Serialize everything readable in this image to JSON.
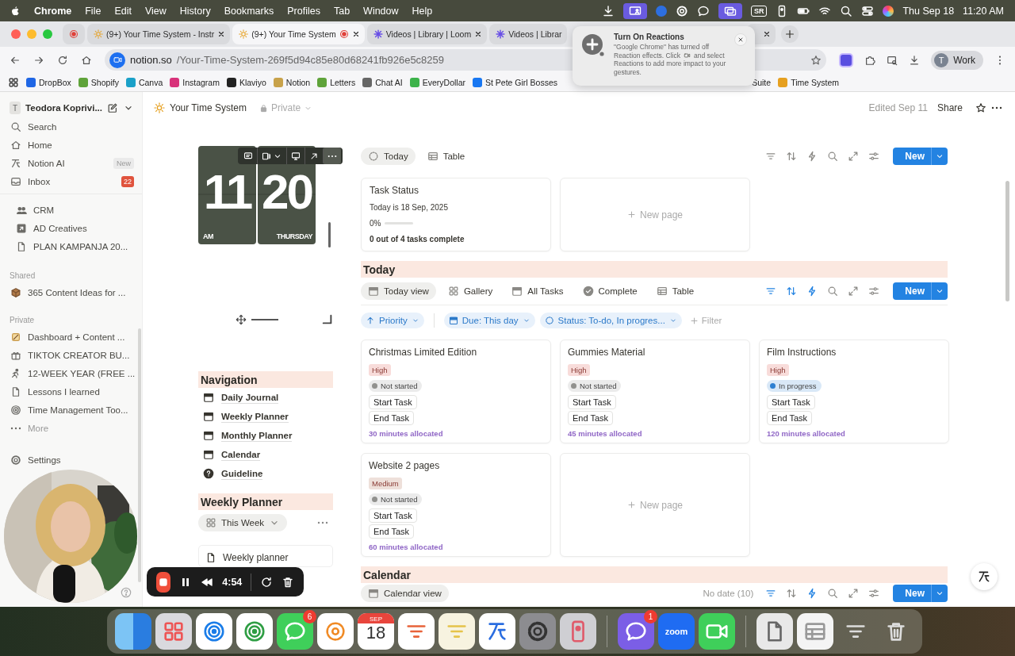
{
  "menubar": {
    "app": "Chrome",
    "menus": [
      "File",
      "Edit",
      "View",
      "History",
      "Bookmarks",
      "Profiles",
      "Tab",
      "Window",
      "Help"
    ],
    "status_label": "SR",
    "date": "Thu Sep 18",
    "time": "11:20 AM"
  },
  "tabs": [
    {
      "kind": "pinned",
      "selected": false,
      "recording": true,
      "closable": false
    },
    {
      "kind": "sun",
      "title": "(9+) Your Time System - Instr",
      "selected": false,
      "recording": false,
      "closable": true
    },
    {
      "kind": "sun",
      "title": "(9+) Your Time System",
      "selected": true,
      "recording": true,
      "closable": true
    },
    {
      "kind": "asterisk",
      "title": "Videos | Library | Loom",
      "selected": false,
      "recording": false,
      "closable": true
    },
    {
      "kind": "asterisk",
      "title": "Videos | Librar",
      "selected": false,
      "recording": false,
      "closable": false
    },
    {
      "kind": "blank",
      "selected": false,
      "recording": false,
      "closable": true
    }
  ],
  "address": {
    "host": "notion.so",
    "path": "/Your-Time-System-269f5d94c85e80d68241fb926e5c8259"
  },
  "profile": {
    "initial": "T",
    "label": "Work"
  },
  "bookmarks": [
    {
      "label": "DropBox",
      "favicon": true
    },
    {
      "label": "Shopify",
      "favicon": true
    },
    {
      "label": "Canva",
      "favicon": true
    },
    {
      "label": "Instagram",
      "favicon": true
    },
    {
      "label": "Klaviyo",
      "favicon": true
    },
    {
      "label": "Notion",
      "favicon": true
    },
    {
      "label": "Letters",
      "favicon": true
    },
    {
      "label": "Chat AI",
      "favicon": true
    },
    {
      "label": "EveryDollar",
      "favicon": true
    },
    {
      "label": "St Pete Girl Bosses",
      "favicon": true
    },
    {
      "label": "Suite",
      "favicon": false
    },
    {
      "label": "Time System",
      "favicon": true
    }
  ],
  "popup": {
    "title": "Turn On Reactions",
    "lines": [
      "\"Google Chrome\" has turned off",
      "Reaction effects. Click",
      "and select",
      "Reactions to add more impact to your",
      "gestures."
    ]
  },
  "sidebar": {
    "workspace": {
      "initial": "T",
      "name": "Teodora Koprivi..."
    },
    "nav": [
      {
        "label": "Search"
      },
      {
        "label": "Home"
      },
      {
        "label": "Notion AI",
        "badge": "New"
      },
      {
        "label": "Inbox",
        "count": "22"
      }
    ],
    "pages": [
      "CRM",
      "AD Creatives",
      "PLAN KAMPANJA 20..."
    ],
    "shared_label": "Shared",
    "shared": [
      "365 Content Ideas for ..."
    ],
    "private_label": "Private",
    "private": [
      "Dashboard + Content ...",
      "TIKTOK CREATOR BU...",
      "12-WEEK YEAR (FREE ...",
      "Lessons I learned",
      "Time Management Too..."
    ],
    "more": "More",
    "settings": "Settings"
  },
  "page": {
    "title": "Your Time System",
    "visibility": "Private",
    "edited": "Edited Sep 11",
    "share": "Share",
    "clock": {
      "hour": "11",
      "minute": "20",
      "period": "AM",
      "weekday": "THURSDAY"
    },
    "navigation": {
      "heading": "Navigation",
      "links": [
        {
          "label": "Daily Journal",
          "kind": "calendar"
        },
        {
          "label": "Weekly Planner",
          "kind": "calendar"
        },
        {
          "label": "Monthly Planner",
          "kind": "calendar"
        },
        {
          "label": "Calendar",
          "kind": "calendar"
        },
        {
          "label": "Guideline",
          "kind": "help"
        }
      ]
    },
    "weekly_planner": {
      "heading": "Weekly Planner",
      "view": "This Week",
      "items": [
        "Weekly planner"
      ]
    },
    "status_db": {
      "views": [
        {
          "label": "Today",
          "selected": true
        },
        {
          "label": "Table",
          "selected": false
        }
      ],
      "filter_on": false,
      "sort_on": false,
      "automation_on": false,
      "new": "New",
      "task_status": {
        "title": "Task Status",
        "date": "Today is 18 Sep, 2025",
        "percent": "0%",
        "summary": "0 out of 4 tasks complete"
      },
      "new_page": "New page"
    },
    "today": {
      "heading": "Today",
      "views": [
        {
          "label": "Today view",
          "selected": true
        },
        {
          "label": "Gallery",
          "selected": false
        },
        {
          "label": "All Tasks",
          "selected": false
        },
        {
          "label": "Complete",
          "selected": false
        },
        {
          "label": "Table",
          "selected": false
        }
      ],
      "filter_on": true,
      "sort_on": true,
      "automation_on": true,
      "new": "New",
      "filters": [
        {
          "kind": "priority",
          "label": "Priority"
        },
        {
          "kind": "date",
          "label": "Due: This day"
        },
        {
          "kind": "status",
          "label": "Status: To-do, In progres..."
        }
      ],
      "add_filter": "Filter",
      "cards": [
        {
          "title": "Christmas Limited Edition",
          "priority": {
            "label": "High",
            "color": "#f8dcda"
          },
          "status": {
            "label": "Not started",
            "color": "#91918e"
          },
          "start": "Start Task",
          "end": "End Task",
          "allocation": "30 minutes allocated"
        },
        {
          "title": "Gummies Material",
          "priority": {
            "label": "High",
            "color": "#f8dcda"
          },
          "status": {
            "label": "Not started",
            "color": "#91918e"
          },
          "start": "Start Task",
          "end": "End Task",
          "allocation": "45 minutes allocated"
        },
        {
          "title": "Film Instructions",
          "priority": {
            "label": "High",
            "color": "#f8dcda"
          },
          "status": {
            "label": "In progress",
            "color": "#2f80d1"
          },
          "start": "Start Task",
          "end": "End Task",
          "allocation": "120 minutes allocated"
        },
        {
          "title": "Website 2 pages",
          "priority": {
            "label": "Medium",
            "color": "#eee0da"
          },
          "status": {
            "label": "Not started",
            "color": "#91918e"
          },
          "start": "Start Task",
          "end": "End Task",
          "allocation": "60 minutes allocated"
        }
      ],
      "new_page": "New page"
    },
    "calendar": {
      "heading": "Calendar",
      "view": "Calendar view",
      "no_date": "No date (10)",
      "filter_on": true,
      "sort_on": false,
      "automation_on": true,
      "new": "New"
    }
  },
  "recorder": {
    "time": "4:54"
  },
  "dock": {
    "calendar_month": "SEP",
    "calendar_day": "18",
    "messages_badge": "6",
    "calls_badge": "1",
    "video_app_label": "zoom"
  }
}
